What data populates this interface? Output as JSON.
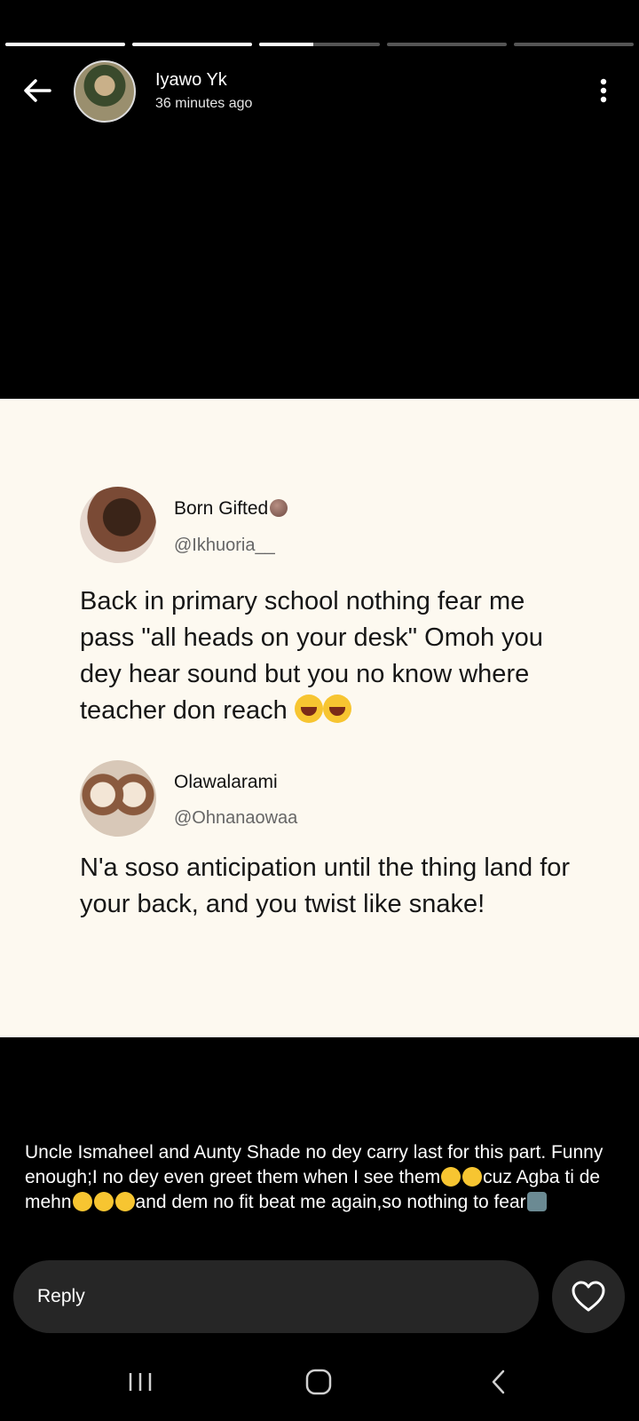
{
  "story": {
    "progress": [
      1.0,
      1.0,
      0.45,
      0.0,
      0.0
    ],
    "author_name": "Iyawo Yk",
    "posted_ago": "36 minutes ago"
  },
  "tweets": [
    {
      "name": "Born Gifted",
      "handle": "@Ikhuoria__",
      "text": "Back in primary school nothing fear me pass \"all heads on your desk\" Omoh you dey hear sound but you no know where teacher don reach"
    },
    {
      "name": "Olawalarami",
      "handle": "@Ohnanaowaa",
      "text": "N'a soso anticipation until the thing land for your back, and you twist like snake!"
    }
  ],
  "caption": {
    "part1": "Uncle Ismaheel and Aunty Shade no dey carry last for this part. Funny enough;I no dey even greet them when I see them",
    "part2": "cuz Agba ti de mehn",
    "part3": "and dem no fit beat me again,so nothing to fear"
  },
  "reply": {
    "placeholder": "Reply"
  },
  "icons": {
    "back": "arrow-left-icon",
    "more": "more-vertical-icon",
    "like": "heart-icon",
    "nav_recent": "recent-apps-icon",
    "nav_home": "home-icon",
    "nav_back": "nav-back-icon"
  },
  "colors": {
    "background": "#000000",
    "card": "#fdf9f0",
    "reply_bg": "#262626"
  }
}
